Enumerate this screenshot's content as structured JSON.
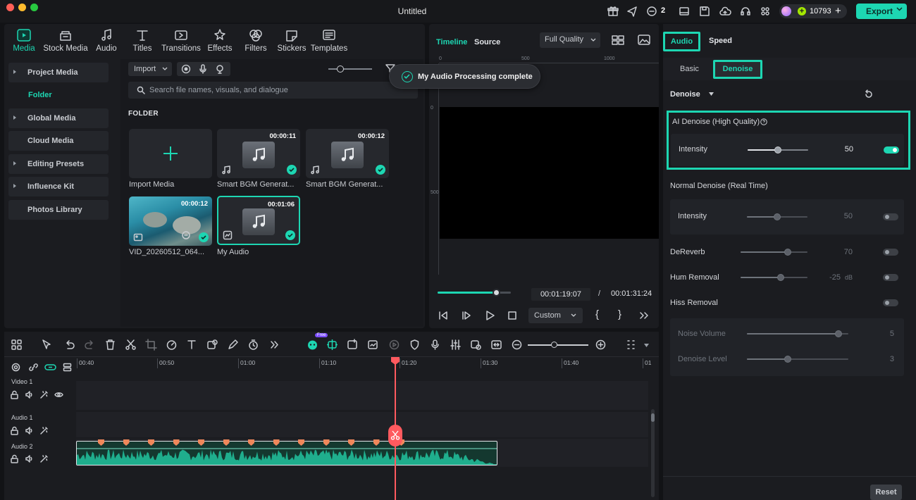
{
  "window": {
    "title": "Untitled"
  },
  "topbar": {
    "notification_count": "2",
    "credits": "10793",
    "export_label": "Export"
  },
  "media_tabs": [
    {
      "label": "Media",
      "icon": "media-icon",
      "active": true
    },
    {
      "label": "Stock Media",
      "icon": "stock-media-icon"
    },
    {
      "label": "Audio",
      "icon": "music-note-icon"
    },
    {
      "label": "Titles",
      "icon": "titles-icon"
    },
    {
      "label": "Transitions",
      "icon": "transitions-icon"
    },
    {
      "label": "Effects",
      "icon": "effects-icon"
    },
    {
      "label": "Filters",
      "icon": "filters-icon"
    },
    {
      "label": "Stickers",
      "icon": "stickers-icon"
    },
    {
      "label": "Templates",
      "icon": "templates-icon"
    }
  ],
  "sidebar": {
    "items": [
      {
        "label": "Project Media",
        "expandable": true
      },
      {
        "label": "Global Media",
        "expandable": true
      },
      {
        "label": "Cloud Media",
        "expandable": false
      },
      {
        "label": "Editing Presets",
        "expandable": true
      },
      {
        "label": "Influence Kit",
        "expandable": true
      },
      {
        "label": "Photos Library",
        "expandable": false
      }
    ],
    "folder_label": "Folder"
  },
  "media": {
    "import_label": "Import",
    "search_placeholder": "Search file names, visuals, and dialogue",
    "folder_heading": "FOLDER",
    "items": [
      {
        "caption": "Import Media",
        "kind": "import"
      },
      {
        "caption": "Smart BGM Generat...",
        "kind": "audio",
        "duration": "00:00:11"
      },
      {
        "caption": "Smart BGM Generat...",
        "kind": "audio",
        "duration": "00:00:12"
      },
      {
        "caption": "VID_20260512_064...",
        "kind": "video",
        "duration": "00:00:12"
      },
      {
        "caption": "My Audio",
        "kind": "audio",
        "duration": "00:01:06",
        "selected": true
      }
    ]
  },
  "toast": {
    "message": "My Audio Processing complete"
  },
  "preview": {
    "tab_timeline": "Timeline",
    "tab_source": "Source",
    "quality": "Full Quality",
    "ruler_ticks": [
      "0",
      "500",
      "1000"
    ],
    "ruler_left_ticks": [
      "0",
      "500"
    ],
    "current_time": "00:01:19:07",
    "separator": "/",
    "total_time": "00:01:31:24",
    "progress": 0.8,
    "speed_select": "Custom",
    "brace_open": "{",
    "brace_close": "}"
  },
  "right_panel": {
    "tab_audio": "Audio",
    "tab_speed": "Speed",
    "sub_basic": "Basic",
    "sub_denoise": "Denoise",
    "section_title": "Denoise",
    "ai_denoise": {
      "title": "AI Denoise (High Quality)",
      "label": "Intensity",
      "value": "50",
      "level": 0.5,
      "enabled": true
    },
    "normal_denoise": {
      "title": "Normal Denoise (Real Time)",
      "label": "Intensity",
      "value": "50",
      "level": 0.5,
      "enabled": false
    },
    "dereverb": {
      "label": "DeReverb",
      "value": "70",
      "level": 0.7,
      "enabled": false
    },
    "hum_removal": {
      "label": "Hum Removal",
      "value": "-25",
      "unit": "dB",
      "level": 0.6,
      "enabled": false
    },
    "hiss_removal": {
      "label": "Hiss Removal",
      "enabled": false
    },
    "noise_volume": {
      "label": "Noise Volume",
      "value": "5",
      "level": 0.9
    },
    "denoise_level": {
      "label": "Denoise Level",
      "value": "3",
      "level": 0.4
    },
    "reset_label": "Reset"
  },
  "timeline": {
    "ruler": [
      "00:40",
      "00:50",
      "01:00",
      "01:10",
      "01:20",
      "01:30",
      "01:40",
      "01"
    ],
    "tracks": [
      {
        "name": "Video 1"
      },
      {
        "name": "Audio 1"
      },
      {
        "name": "Audio 2"
      }
    ],
    "ai_badge": "Free"
  },
  "colors": {
    "accent": "#1dd6b2",
    "playhead": "#ff5a5f",
    "marker": "#f0875a",
    "background": "#1b1c20"
  }
}
